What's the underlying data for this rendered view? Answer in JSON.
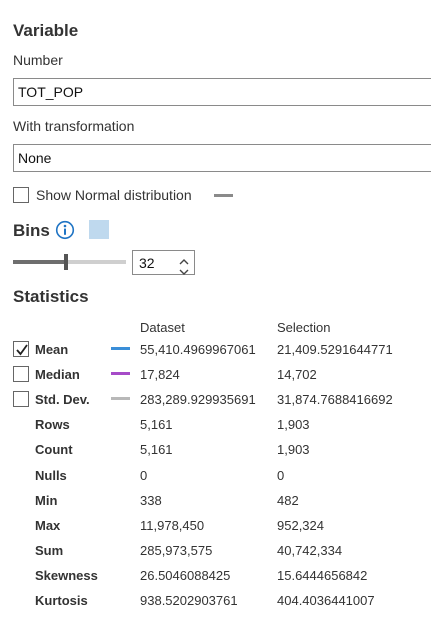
{
  "variable": {
    "title": "Variable",
    "number_label": "Number",
    "number_value": "TOT_POP",
    "transform_label": "With transformation",
    "transform_value": "None",
    "show_normal_label": "Show Normal distribution",
    "show_normal_checked": false
  },
  "bins": {
    "title": "Bins",
    "value": "32",
    "swatch_color": "#bfd9ee",
    "slider_fraction": 0.47
  },
  "statistics": {
    "title": "Statistics",
    "col_dataset": "Dataset",
    "col_selection": "Selection",
    "rows": [
      {
        "name": "Mean",
        "checkbox": true,
        "checked": true,
        "line_color": "#3a8ed8",
        "dataset": "55,410.4969967061",
        "selection": "21,409.5291644771"
      },
      {
        "name": "Median",
        "checkbox": true,
        "checked": false,
        "line_color": "#a64bc8",
        "dataset": "17,824",
        "selection": "14,702"
      },
      {
        "name": "Std. Dev.",
        "checkbox": true,
        "checked": false,
        "line_color": "#b8b8b8",
        "dataset": "283,289.929935691",
        "selection": "31,874.7688416692"
      },
      {
        "name": "Rows",
        "checkbox": false,
        "dataset": "5,161",
        "selection": "1,903"
      },
      {
        "name": "Count",
        "checkbox": false,
        "dataset": "5,161",
        "selection": "1,903"
      },
      {
        "name": "Nulls",
        "checkbox": false,
        "dataset": "0",
        "selection": "0"
      },
      {
        "name": "Min",
        "checkbox": false,
        "dataset": "338",
        "selection": "482"
      },
      {
        "name": "Max",
        "checkbox": false,
        "dataset": "11,978,450",
        "selection": "952,324"
      },
      {
        "name": "Sum",
        "checkbox": false,
        "dataset": "285,973,575",
        "selection": "40,742,334"
      },
      {
        "name": "Skewness",
        "checkbox": false,
        "dataset": "26.5046088425",
        "selection": "15.6444656842"
      },
      {
        "name": "Kurtosis",
        "checkbox": false,
        "dataset": "938.5202903761",
        "selection": "404.4036441007"
      }
    ]
  }
}
